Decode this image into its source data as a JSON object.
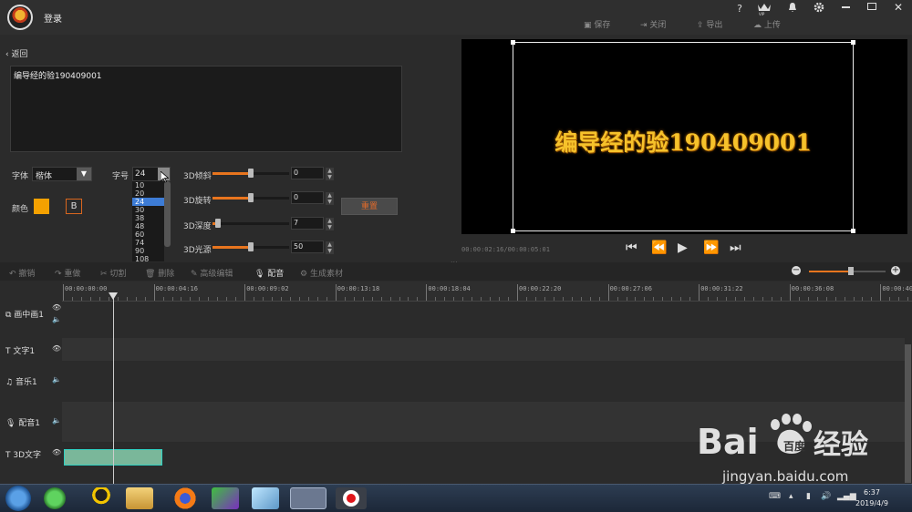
{
  "topbar": {
    "login": "登录",
    "help_icon": "?",
    "vip_icon": "VIP",
    "actions": {
      "save": "保存",
      "close": "关闭",
      "export": "导出",
      "upload": "上传"
    }
  },
  "editor": {
    "back": "返回",
    "text_value": "编导经的验190409001",
    "font_label": "字体",
    "font_value": "楷体",
    "size_label": "字号",
    "size_value": "24",
    "size_options": [
      "10",
      "20",
      "24",
      "30",
      "38",
      "48",
      "60",
      "74",
      "90",
      "108"
    ],
    "size_selected": "24",
    "color_label": "颜色",
    "color_value": "#f5a100",
    "bold_label": "B",
    "sliders": [
      {
        "label": "3D倾斜",
        "value": "0",
        "level": 0.5
      },
      {
        "label": "3D旋转",
        "value": "0",
        "level": 0.5
      },
      {
        "label": "3D深度",
        "value": "7",
        "level": 0.07
      },
      {
        "label": "3D光源",
        "value": "50",
        "level": 0.5
      }
    ],
    "reset": "重置"
  },
  "preview": {
    "text": "编导经的验190409001",
    "timecode": "00:00:02:16/00:00:05:01"
  },
  "toolbar": {
    "undo": "撤销",
    "redo": "重做",
    "cut": "切割",
    "delete": "删除",
    "advanced": "高级编辑",
    "dub": "配音",
    "generate": "生成素材"
  },
  "ruler": {
    "ticks": [
      "00:00:00:00",
      "00:00:04:16",
      "00:00:09:02",
      "00:00:13:18",
      "00:00:18:04",
      "00:00:22:20",
      "00:00:27:06",
      "00:00:31:22",
      "00:00:36:08",
      "00:00:40:"
    ]
  },
  "tracks": [
    {
      "label": "画中画1"
    },
    {
      "label": "文字1"
    },
    {
      "label": "音乐1"
    },
    {
      "label": "配音1"
    },
    {
      "label": "3D文字"
    }
  ],
  "taskbar": {
    "time": "6:37",
    "date": "2019/4/9"
  },
  "watermark": {
    "brand": "Bai",
    "brand2": "百度",
    "suffix": "经验",
    "url": "jingyan.baidu.com"
  },
  "colors": {
    "accent": "#e8751e",
    "preview_text": "#f6c22b",
    "selection": "#3d7cd6"
  }
}
